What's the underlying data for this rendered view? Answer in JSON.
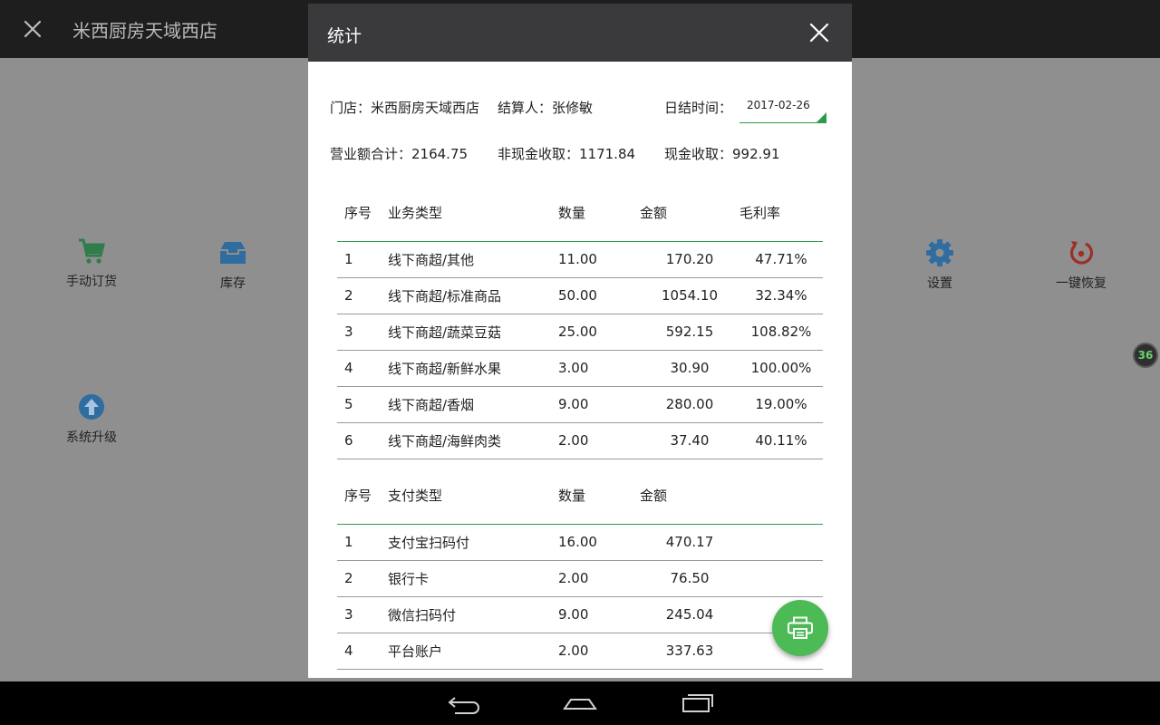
{
  "app": {
    "title": "米西厨房天域西店",
    "tiles": [
      {
        "label": "手动订货",
        "icon": "cart-icon"
      },
      {
        "label": "库存",
        "icon": "inbox-icon"
      },
      {
        "label": "设置",
        "icon": "gear-icon"
      },
      {
        "label": "一键恢复",
        "icon": "restore-icon"
      },
      {
        "label": "系统升级",
        "icon": "upgrade-icon"
      }
    ],
    "side_badge": "36"
  },
  "dialog": {
    "title": "统计",
    "store": "门店：米西厨房天域西店",
    "settler": "结算人：张修敏",
    "date_label": "日结时间：",
    "date_value": "2017-02-26",
    "revenue_total": "营业额合计：2164.75",
    "non_cash": "非现金收取：1171.84",
    "cash": "现金收取：992.91",
    "business_table": {
      "headers": [
        "序号",
        "业务类型",
        "数量",
        "金额",
        "毛利率"
      ],
      "rows": [
        [
          "1",
          "线下商超/其他",
          "11.00",
          "170.20",
          "47.71%"
        ],
        [
          "2",
          "线下商超/标准商品",
          "50.00",
          "1054.10",
          "32.34%"
        ],
        [
          "3",
          "线下商超/蔬菜豆菇",
          "25.00",
          "592.15",
          "108.82%"
        ],
        [
          "4",
          "线下商超/新鲜水果",
          "3.00",
          "30.90",
          "100.00%"
        ],
        [
          "5",
          "线下商超/香烟",
          "9.00",
          "280.00",
          "19.00%"
        ],
        [
          "6",
          "线下商超/海鲜肉类",
          "2.00",
          "37.40",
          "40.11%"
        ]
      ]
    },
    "payment_table": {
      "headers": [
        "序号",
        "支付类型",
        "数量",
        "金额"
      ],
      "rows": [
        [
          "1",
          "支付宝扫码付",
          "16.00",
          "470.17"
        ],
        [
          "2",
          "银行卡",
          "2.00",
          "76.50"
        ],
        [
          "3",
          "微信扫码付",
          "9.00",
          "245.04"
        ],
        [
          "4",
          "平台账户",
          "2.00",
          "337.63"
        ]
      ]
    }
  },
  "colors": {
    "accent_green": "#2a9d4a",
    "fab_green": "#4cba55",
    "header_dark": "#3a3a3c"
  }
}
